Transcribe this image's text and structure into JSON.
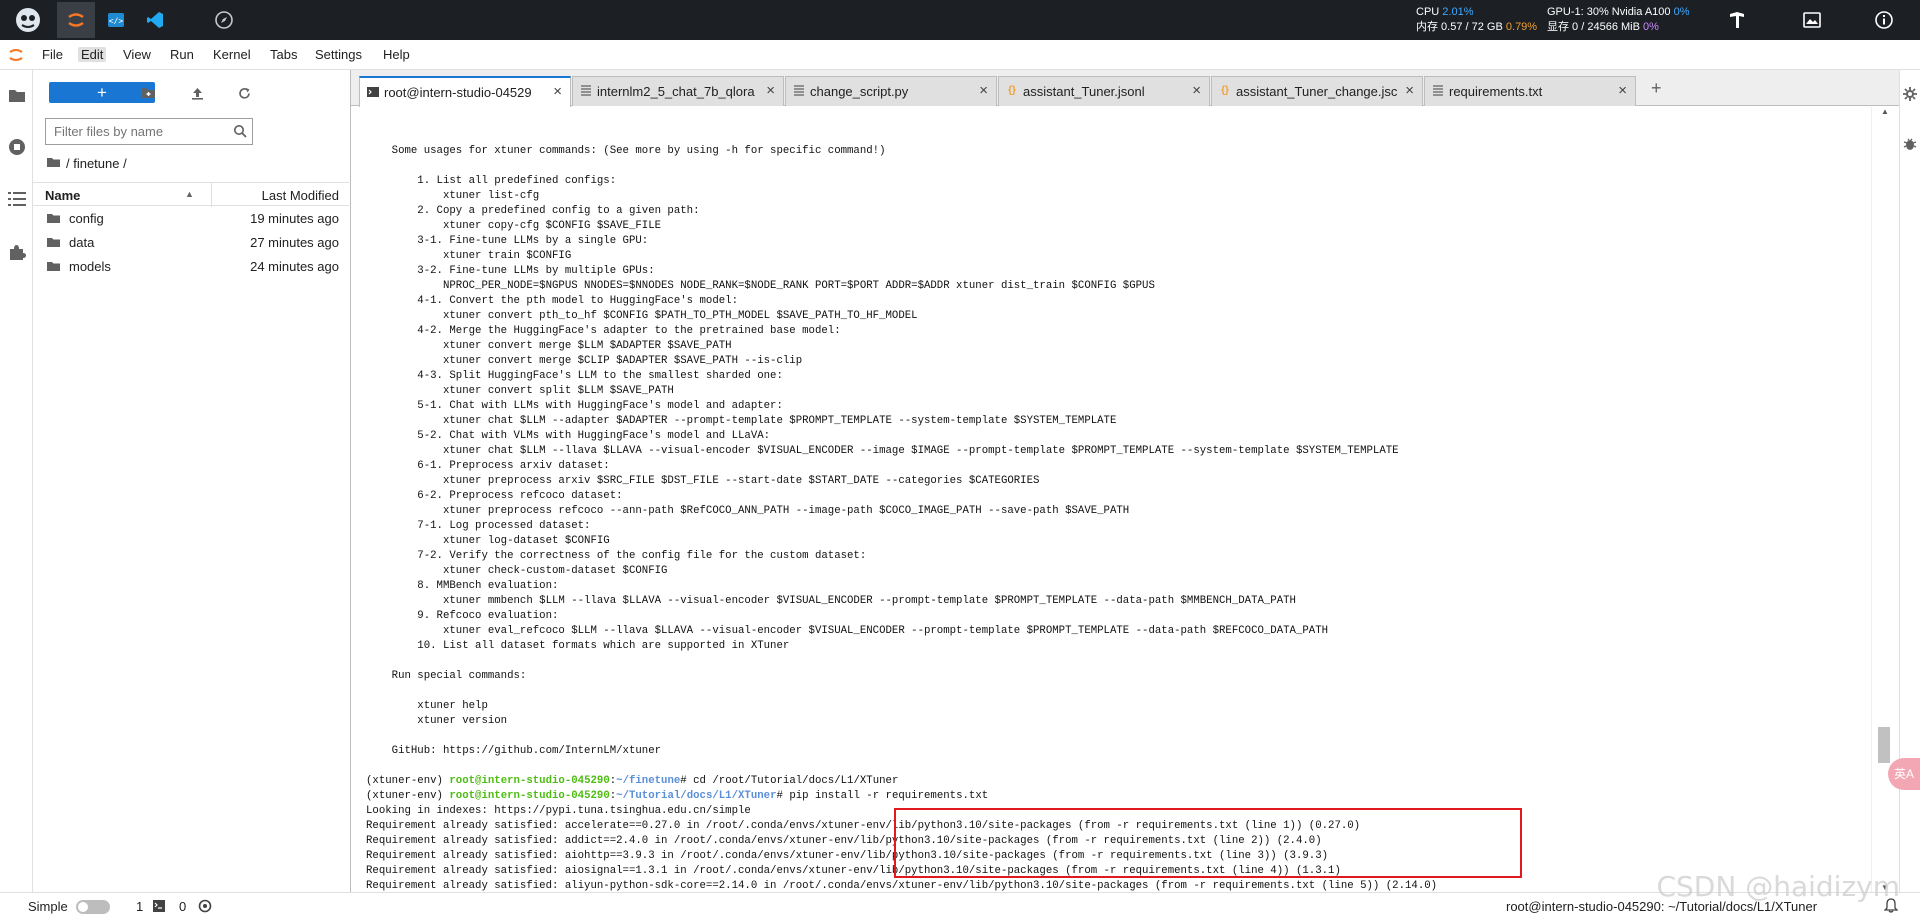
{
  "topbar": {
    "resources": {
      "cpu_label": "CPU",
      "cpu_pct": "2.01%",
      "mem_label": "内存 0.57 / 72 GB",
      "mem_pct": "0.79%",
      "gpu_label": "GPU-1: 30% Nvidia A100",
      "gpu_pct": "0%",
      "vram_label": "显存 0 / 24566 MiB",
      "vram_pct": "0%"
    },
    "icons": [
      "intern-logo-icon",
      "jupyter-icon",
      "vscode-web-icon",
      "vscode-icon",
      "compass-icon",
      "model-icon",
      "image-icon",
      "info-icon"
    ]
  },
  "menubar": {
    "items": [
      "File",
      "Edit",
      "View",
      "Run",
      "Kernel",
      "Tabs",
      "Settings",
      "Help"
    ]
  },
  "filebrowser": {
    "new_label": "+",
    "search_placeholder": "Filter files by name",
    "breadcrumb": "/ finetune /",
    "col_name": "Name",
    "col_modified": "Last Modified",
    "files": [
      {
        "name": "config",
        "modified": "19 minutes ago"
      },
      {
        "name": "data",
        "modified": "27 minutes ago"
      },
      {
        "name": "models",
        "modified": "24 minutes ago"
      }
    ]
  },
  "tabs": [
    {
      "label": "root@intern-studio-04529",
      "icon": "terminal-icon",
      "active": true
    },
    {
      "label": "internlm2_5_chat_7b_qlora",
      "icon": "file-icon",
      "active": false
    },
    {
      "label": "change_script.py",
      "icon": "file-icon",
      "active": false
    },
    {
      "label": "assistant_Tuner.jsonl",
      "icon": "json-icon",
      "active": false
    },
    {
      "label": "assistant_Tuner_change.jsc",
      "icon": "json-icon",
      "active": false
    },
    {
      "label": "requirements.txt",
      "icon": "file-icon",
      "active": false
    }
  ],
  "terminal": {
    "lines": [
      "    Some usages for xtuner commands: (See more by using -h for specific command!)",
      "",
      "        1. List all predefined configs:",
      "            xtuner list-cfg",
      "        2. Copy a predefined config to a given path:",
      "            xtuner copy-cfg $CONFIG $SAVE_FILE",
      "        3-1. Fine-tune LLMs by a single GPU:",
      "            xtuner train $CONFIG",
      "        3-2. Fine-tune LLMs by multiple GPUs:",
      "            NPROC_PER_NODE=$NGPUS NNODES=$NNODES NODE_RANK=$NODE_RANK PORT=$PORT ADDR=$ADDR xtuner dist_train $CONFIG $GPUS",
      "        4-1. Convert the pth model to HuggingFace's model:",
      "            xtuner convert pth_to_hf $CONFIG $PATH_TO_PTH_MODEL $SAVE_PATH_TO_HF_MODEL",
      "        4-2. Merge the HuggingFace's adapter to the pretrained base model:",
      "            xtuner convert merge $LLM $ADAPTER $SAVE_PATH",
      "            xtuner convert merge $CLIP $ADAPTER $SAVE_PATH --is-clip",
      "        4-3. Split HuggingFace's LLM to the smallest sharded one:",
      "            xtuner convert split $LLM $SAVE_PATH",
      "        5-1. Chat with LLMs with HuggingFace's model and adapter:",
      "            xtuner chat $LLM --adapter $ADAPTER --prompt-template $PROMPT_TEMPLATE --system-template $SYSTEM_TEMPLATE",
      "        5-2. Chat with VLMs with HuggingFace's model and LLaVA:",
      "            xtuner chat $LLM --llava $LLAVA --visual-encoder $VISUAL_ENCODER --image $IMAGE --prompt-template $PROMPT_TEMPLATE --system-template $SYSTEM_TEMPLATE",
      "        6-1. Preprocess arxiv dataset:",
      "            xtuner preprocess arxiv $SRC_FILE $DST_FILE --start-date $START_DATE --categories $CATEGORIES",
      "        6-2. Preprocess refcoco dataset:",
      "            xtuner preprocess refcoco --ann-path $RefCOCO_ANN_PATH --image-path $COCO_IMAGE_PATH --save-path $SAVE_PATH",
      "        7-1. Log processed dataset:",
      "            xtuner log-dataset $CONFIG",
      "        7-2. Verify the correctness of the config file for the custom dataset:",
      "            xtuner check-custom-dataset $CONFIG",
      "        8. MMBench evaluation:",
      "            xtuner mmbench $LLM --llava $LLAVA --visual-encoder $VISUAL_ENCODER --prompt-template $PROMPT_TEMPLATE --data-path $MMBENCH_DATA_PATH",
      "        9. Refcoco evaluation:",
      "            xtuner eval_refcoco $LLM --llava $LLAVA --visual-encoder $VISUAL_ENCODER --prompt-template $PROMPT_TEMPLATE --data-path $REFCOCO_DATA_PATH",
      "        10. List all dataset formats which are supported in XTuner",
      "",
      "    Run special commands:",
      "",
      "        xtuner help",
      "        xtuner version",
      "",
      "    GitHub: https://github.com/InternLM/xtuner",
      ""
    ],
    "prompt1": {
      "env": "(xtuner-env) ",
      "user": "root@intern-studio-045290",
      "sep": ":",
      "path": "~/finetune",
      "cmd": "# cd /root/Tutorial/docs/L1/XTuner"
    },
    "prompt2": {
      "env": "(xtuner-env) ",
      "user": "root@intern-studio-045290",
      "sep": ":",
      "path": "~/Tutorial/docs/L1/XTuner",
      "cmd": "# pip install -r requirements.txt"
    },
    "output": [
      "Looking in indexes: https://pypi.tuna.tsinghua.edu.cn/simple",
      "Requirement already satisfied: accelerate==0.27.0 in /root/.conda/envs/xtuner-env/lib/python3.10/site-packages (from -r requirements.txt (line 1)) (0.27.0)",
      "Requirement already satisfied: addict==2.4.0 in /root/.conda/envs/xtuner-env/lib/python3.10/site-packages (from -r requirements.txt (line 2)) (2.4.0)",
      "Requirement already satisfied: aiohttp==3.9.3 in /root/.conda/envs/xtuner-env/lib/python3.10/site-packages (from -r requirements.txt (line 3)) (3.9.3)",
      "Requirement already satisfied: aiosignal==1.3.1 in /root/.conda/envs/xtuner-env/lib/python3.10/site-packages (from -r requirements.txt (line 4)) (1.3.1)",
      "Requirement already satisfied: aliyun-python-sdk-core==2.14.0 in /root/.conda/envs/xtuner-env/lib/python3.10/site-packages (from -r requirements.txt (line 5)) (2.14.0)"
    ]
  },
  "statusbar": {
    "mode": "Simple",
    "count1": "1",
    "count2": "0",
    "right_text": "root@intern-studio-045290: ~/Tutorial/docs/L1/XTuner"
  },
  "watermark": "CSDN @haidizym",
  "float_button": "英A"
}
